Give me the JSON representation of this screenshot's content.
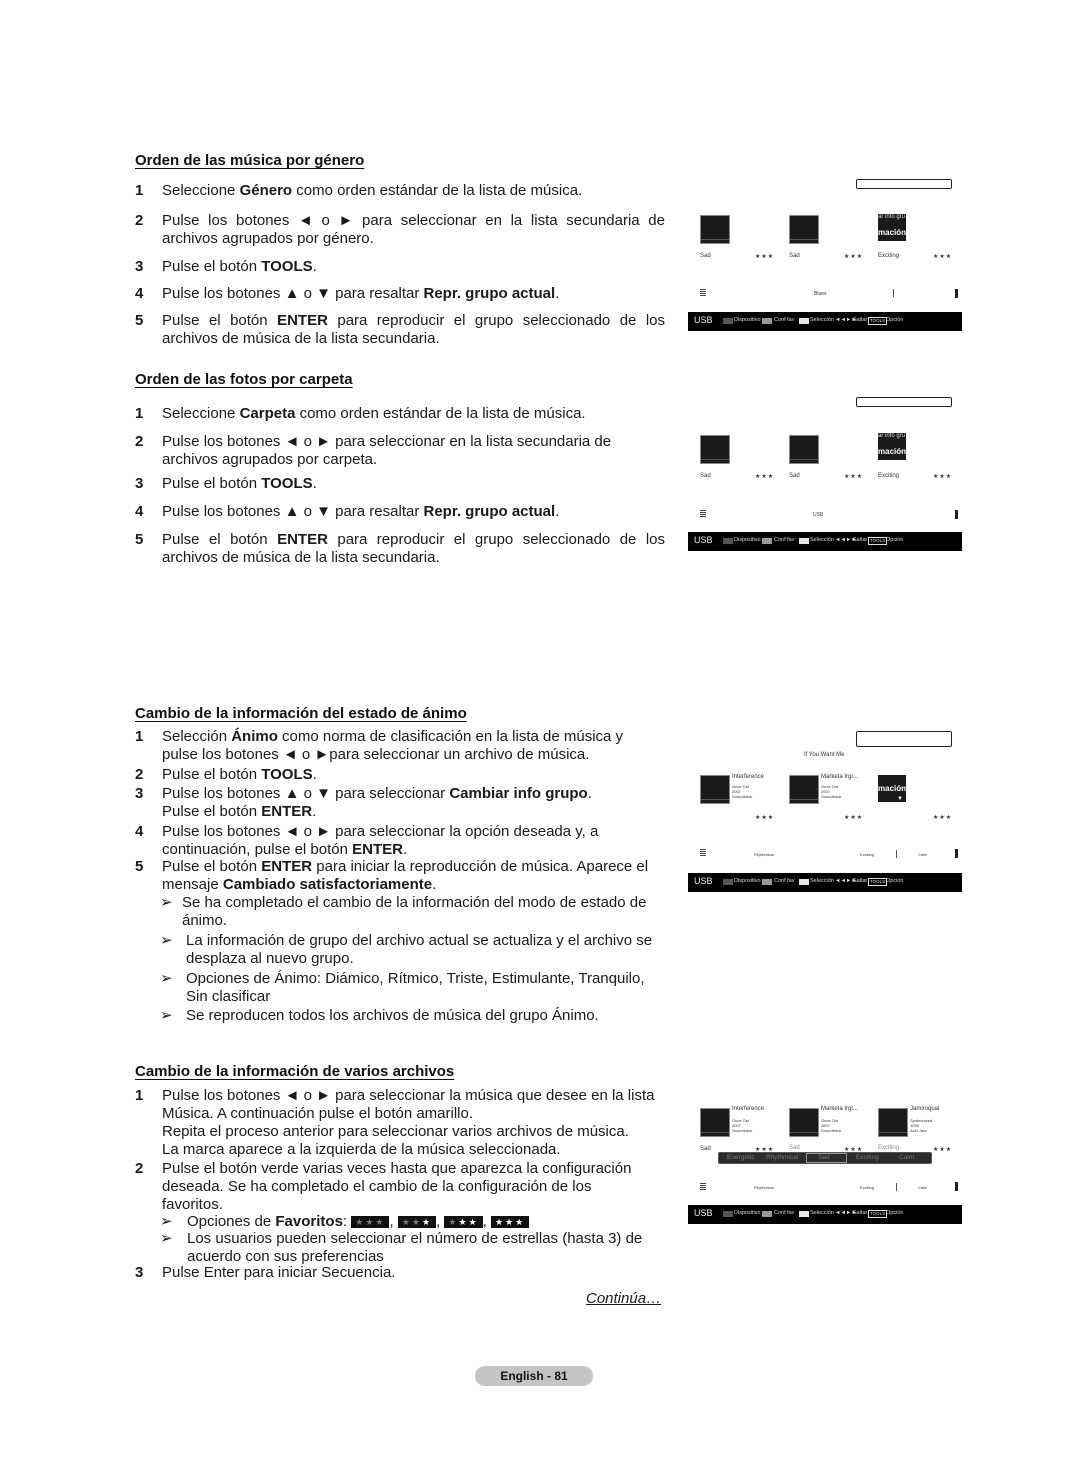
{
  "sections": [
    {
      "title": "Orden de las música por género",
      "steps": [
        {
          "num": "1",
          "pre": "Seleccione ",
          "bold": "Género",
          "post": " como orden estándar de la lista de música."
        },
        {
          "num": "2",
          "text": "Pulse los botones ◄ o ► para seleccionar en la lista secundaria de archivos agrupados por género."
        },
        {
          "num": "3",
          "pre": "Pulse el botón ",
          "bold": "TOOLS",
          "post": "."
        },
        {
          "num": "4",
          "pre": "Pulse los botones ▲ o ▼ para resaltar ",
          "bold": "Repr. grupo actual",
          "post": "."
        },
        {
          "num": "5",
          "pre": "Pulse el botón ",
          "bold": "ENTER",
          "post": " para reproducir el grupo seleccionado de los archivos de música de la lista secundaria."
        }
      ]
    },
    {
      "title": "Orden de las fotos por carpeta",
      "steps": [
        {
          "num": "1",
          "pre": "Seleccione ",
          "bold": "Carpeta",
          "post": " como orden estándar de la lista de música."
        },
        {
          "num": "2",
          "text": "Pulse los botones ◄ o ► para seleccionar en la lista secundaria de archivos agrupados por carpeta."
        },
        {
          "num": "3",
          "pre": "Pulse el botón ",
          "bold": "TOOLS",
          "post": "."
        },
        {
          "num": "4",
          "pre": "Pulse los botones ▲ o ▼ para resaltar ",
          "bold": "Repr. grupo actual",
          "post": "."
        },
        {
          "num": "5",
          "pre": "Pulse el botón ",
          "bold": "ENTER",
          "post": " para reproducir el grupo seleccionado de los archivos de música de la lista secundaria."
        }
      ]
    },
    {
      "title": "Cambio de la información del estado de ánimo",
      "steps": [
        {
          "num": "1",
          "pre": "Selección ",
          "bold": "Ánimo",
          "post": " como norma de clasificación en la lista de música y pulse los botones ◄ o ►para seleccionar un archivo de música."
        },
        {
          "num": "2",
          "pre": "Pulse el botón ",
          "bold": "TOOLS",
          "post": "."
        },
        {
          "num": "3",
          "pre": "Pulse los botones ▲ o ▼ para seleccionar ",
          "bold": "Cambiar info grupo",
          "post": ".",
          "line2_pre": "Pulse el botón ",
          "line2_bold": "ENTER",
          "line2_post": "."
        },
        {
          "num": "4",
          "pre": "Pulse los botones ◄ o ► para seleccionar la opción deseada y, a continuación, pulse el botón ",
          "bold": "ENTER",
          "post": "."
        },
        {
          "num": "5",
          "pre": "Pulse el botón ",
          "bold": "ENTER",
          "post": " para iniciar la reproducción de música. Aparece el mensaje ",
          "bold2": "Cambiado satisfactoriamente",
          "post2": "."
        }
      ],
      "notes": [
        "Se ha completado el cambio de la información del modo de estado de ánimo.",
        "La información de grupo del archivo actual se actualiza y el archivo se desplaza al nuevo grupo.",
        "Opciones de Ánimo: Diámico, Rítmico, Triste, Estimulante, Tranquilo, Sin clasificar",
        "Se reproducen todos los archivos de música del grupo Ánimo."
      ]
    },
    {
      "title": "Cambio de la información de varios archivos",
      "steps": [
        {
          "num": "1",
          "text": "Pulse los botones ◄ o ► para seleccionar la música que desee en la lista Música. A continuación pulse el botón amarillo.",
          "line2": "Repita el proceso anterior para seleccionar varios archivos de música.",
          "line3": "La marca aparece a la izquierda de la música seleccionada."
        },
        {
          "num": "2",
          "text": "Pulse el botón verde varias veces hasta que aparezca la configuración deseada. Se ha completado el cambio de la configuración de los favoritos."
        },
        {
          "num": "3",
          "text": "Pulse Enter para iniciar Secuencia."
        }
      ],
      "notes": [
        {
          "pre": "Opciones de ",
          "bold": "Favoritos",
          "post": ":"
        },
        {
          "text": "Los usuarios pueden seleccionar el número de estrellas (hasta 3) de acuerdo con sus preferencias"
        }
      ],
      "favorite_options": [
        {
          "filled": 0,
          "glyph": "★★★"
        },
        {
          "filled": 1,
          "glyph": "★★★"
        },
        {
          "filled": 2,
          "glyph": "★★★"
        },
        {
          "filled": 3,
          "glyph": "★★★"
        }
      ]
    }
  ],
  "continua": "Continúa…",
  "page_label": "English - 81",
  "screens": {
    "common": {
      "usb": "USB",
      "legend": [
        "Dispositivo",
        "Conf fav",
        "Selección",
        "Saltar",
        "TOOLS",
        "Opción"
      ],
      "skip_icon": "◄◄►►",
      "stars": "★★★",
      "popup_line1": "ar info gru",
      "popup_line2": "mación"
    },
    "screen1": {
      "labels": [
        "Sad",
        "Sad",
        "Exciting"
      ],
      "group": "Blues"
    },
    "screen2": {
      "labels": [
        "Sad",
        "Sad",
        "Exciting"
      ],
      "group": "USB"
    },
    "screen3": {
      "now_playing": "If You Want Me",
      "tracks": [
        {
          "title": "Interference",
          "l1": "Once Ost",
          "l2": "2007",
          "l3": "Soundtrack"
        },
        {
          "title": "Marketa Irgl...",
          "l1": "Once Ost",
          "l2": "2007",
          "l3": "Soundtrack"
        }
      ],
      "groups": [
        "Rhythmical",
        "Exciting",
        "Calm"
      ]
    },
    "screen4": {
      "tracks": [
        {
          "title": "Interference",
          "l1": "Once Ost",
          "l2": "2007",
          "l3": "Soundtrack"
        },
        {
          "title": "Marketa Irgl...",
          "l1": "Once Ost",
          "l2": "2007",
          "l3": "Soundtrack"
        },
        {
          "title": "Jamiroquai",
          "l1": "Synkronized",
          "l2": "1999",
          "l3": "Acid Jazz"
        }
      ],
      "labels": [
        "Sad",
        "Sad",
        "Exciting"
      ],
      "mood_options": [
        "Energetic",
        "Rhythmical",
        "Sad",
        "Exciting",
        "Calm"
      ],
      "mood_selected": "Sad",
      "groups": [
        "Rhythmical",
        "Exciting",
        "Calm"
      ]
    }
  },
  "colors": {
    "legend_chip_1": "#555555",
    "legend_chip_2": "#999999",
    "legend_chip_3": "#e6e6e6",
    "page_pill": "#c4c4c4"
  }
}
